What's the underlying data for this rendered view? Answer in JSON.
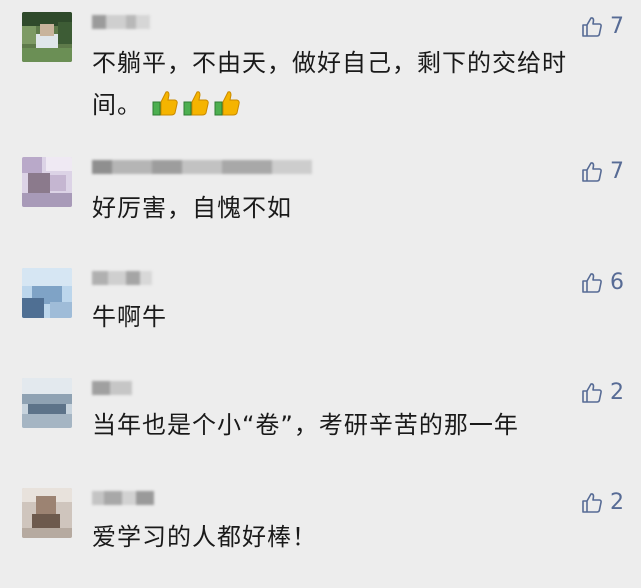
{
  "comments": [
    {
      "text": "不躺平，不由天，做好自己，剩下的交给时间。",
      "emoji_count": 3,
      "likes": "7",
      "accent": "#576b95"
    },
    {
      "text": "好厉害，自愧不如",
      "likes": "7"
    },
    {
      "text": "牛啊牛",
      "likes": "6"
    },
    {
      "text": "当年也是个小“卷”，考研辛苦的那一年",
      "likes": "2"
    },
    {
      "text": "爱学习的人都好棒！",
      "likes": "2"
    }
  ],
  "icons": {
    "like": "thumbs-up-outline-icon",
    "emoji": "thumbs-up-emoji-icon"
  },
  "colors": {
    "background": "#ededed",
    "text": "#1a1a1a",
    "like": "#576b95"
  }
}
